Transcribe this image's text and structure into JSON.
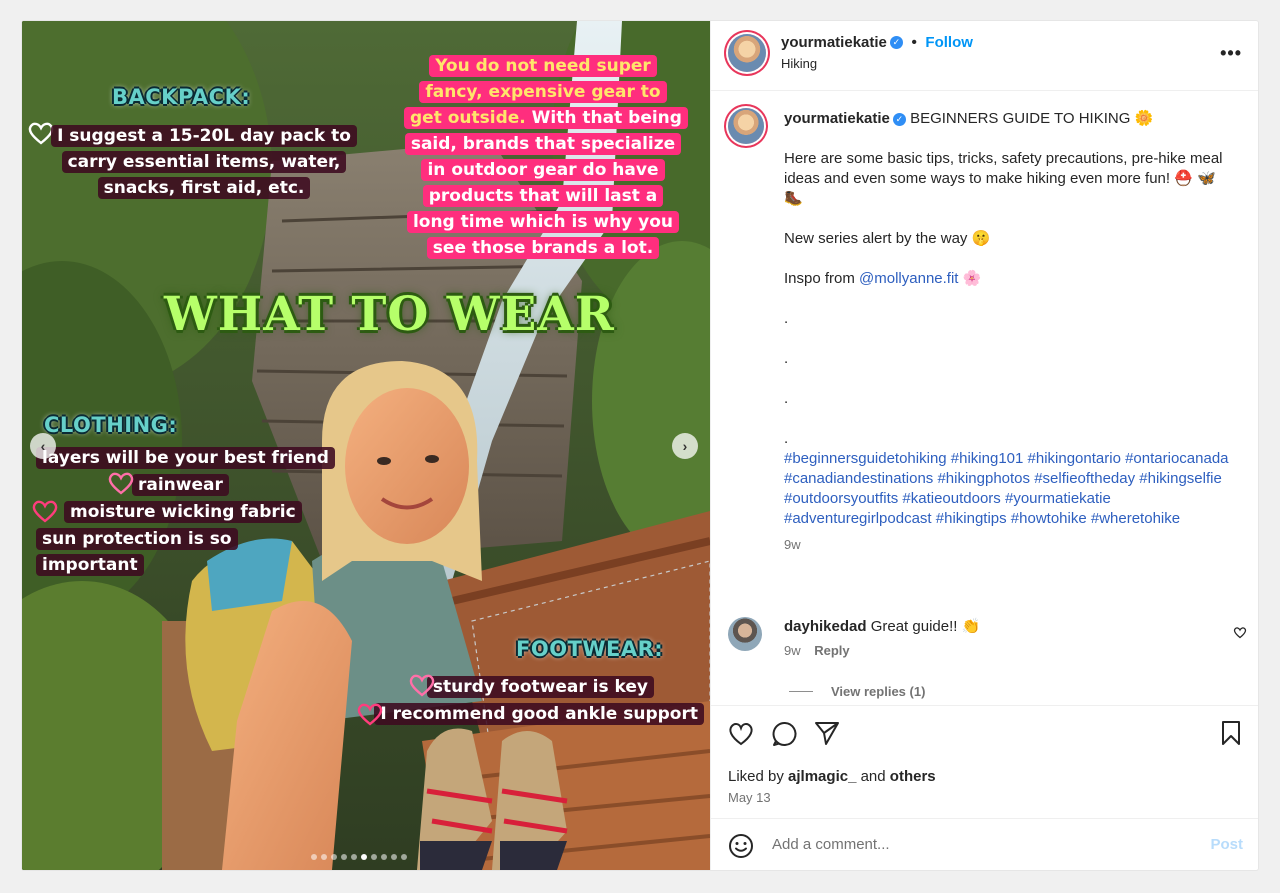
{
  "post": {
    "username": "yourmatiekatie",
    "follow_label": "Follow",
    "location": "Hiking",
    "more_label": "•••"
  },
  "media": {
    "captions": {
      "backpack_heading": "BACKPACK:",
      "backpack_text": "I suggest a 15-20L day pack to carry essential items, water, snacks, first aid, etc.",
      "gear_highlight": "You do not need super fancy, expensive gear to get outside.",
      "gear_text": " With that being said, brands that specialize in outdoor gear do have products that will last a long time which is why you see those brands a lot.",
      "title": "WHAT TO WEAR",
      "clothing_heading": "CLOTHING:",
      "clothing_items": [
        "layers will be your best friend",
        "rainwear",
        "moisture wicking fabric",
        "sun protection is so important"
      ],
      "footwear_heading": "FOOTWEAR:",
      "footwear_items": [
        "sturdy footwear is key",
        "I recommend good ankle support"
      ]
    },
    "prev_icon": "‹",
    "next_icon": "›",
    "slide_count": 10,
    "active_slide": 5
  },
  "caption": {
    "username": "yourmatiekatie",
    "headline": "BEGINNERS GUIDE TO HIKING 🌼",
    "paragraph1": "Here are some basic tips, tricks, safety precautions, pre-hike meal ideas and even some ways to make hiking even more fun! ⛑️ 🦋🥾",
    "paragraph2": "New series alert by the way 🤫",
    "inspo_prefix": "Inspo from ",
    "inspo_mention": "@mollyanne.fit",
    "inspo_suffix": " 🌸",
    "dots": [
      ".",
      ".",
      ".",
      "."
    ],
    "hashtags": "#beginnersguidetohiking #hiking101 #hikingontario #ontariocanada #canadiandestinations #hikingphotos #selfieoftheday #hikingselfie #outdoorsyoutfits #katieoutdoors #yourmatiekatie #adventuregirlpodcast #hikingtips #howtohike #wheretohike",
    "time": "9w"
  },
  "comment": {
    "username": "dayhikedad",
    "text": "Great guide!! 👏",
    "time": "9w",
    "reply_label": "Reply",
    "view_replies": "View replies (1)"
  },
  "footer": {
    "liked_by_prefix": "Liked by ",
    "liked_by_user": "ajlmagic_",
    "liked_by_and": " and ",
    "liked_by_others": "others",
    "date": "May 13",
    "comment_placeholder": "Add a comment...",
    "post_label": "Post"
  },
  "colors": {
    "accent": "#0095f6",
    "link": "#2e5fbf",
    "verified": "#2f8ef5",
    "caption_pink": "#ff2e7e",
    "title_green": "#b6ff6a"
  }
}
